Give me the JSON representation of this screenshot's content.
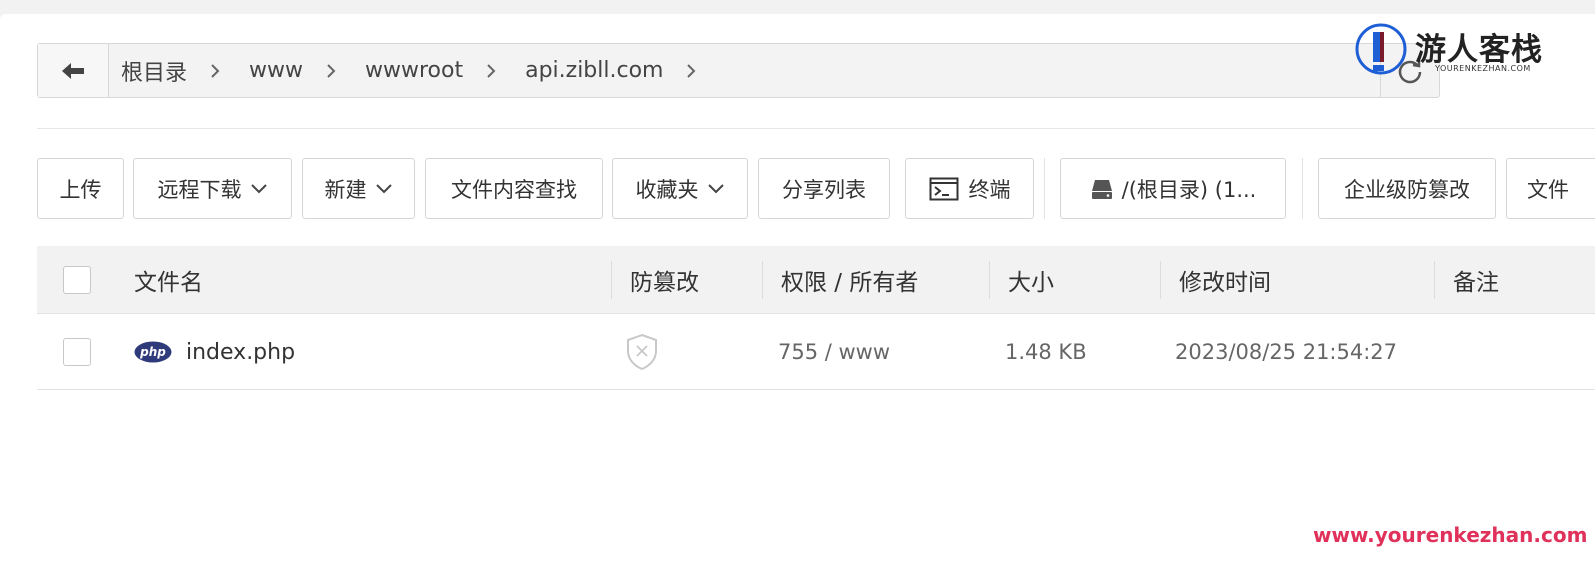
{
  "breadcrumb": {
    "items": [
      "根目录",
      "www",
      "wwwroot",
      "api.zibll.com"
    ]
  },
  "toolbar": {
    "upload": "上传",
    "remote_download": "远程下载",
    "new": "新建",
    "search_content": "文件内容查找",
    "favorites": "收藏夹",
    "share_list": "分享列表",
    "terminal": "终端",
    "disk": "/(根目录) (1...",
    "tamper_proof": "企业级防篡改",
    "more": "文件"
  },
  "table": {
    "headers": {
      "name": "文件名",
      "tamper": "防篡改",
      "perm": "权限 / 所有者",
      "size": "大小",
      "mtime": "修改时间",
      "note": "备注"
    },
    "rows": [
      {
        "name": "index.php",
        "icon_label": "php",
        "perm": "755 / www",
        "size": "1.48 KB",
        "mtime": "2023/08/25 21:54:27",
        "note": ""
      }
    ]
  },
  "watermark": {
    "title": "游人客栈",
    "subtitle": "YOURENKEZHAN.COM",
    "url": "www.yourenkezhan.com"
  },
  "colors": {
    "php_badge": "#2f3a7a",
    "watermark_url": "#e0315b",
    "logo_blue": "#1f5fd6"
  }
}
